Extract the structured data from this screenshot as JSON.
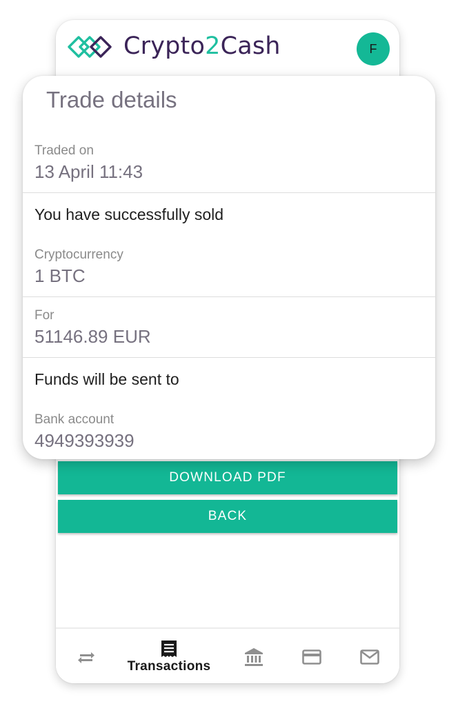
{
  "app": {
    "brand_prefix": "Crypto",
    "brand_digit": "2",
    "brand_suffix": "Cash",
    "avatar_initial": "F",
    "accent_color": "#13b795"
  },
  "modal": {
    "title": "Trade details",
    "traded_on_label": "Traded on",
    "traded_on_value": "13 April 11:43",
    "sold_heading": "You have successfully sold",
    "crypto_label": "Cryptocurrency",
    "crypto_value": "1 BTC",
    "for_label": "For",
    "for_value": "51146.89 EUR",
    "funds_heading": "Funds will be sent to",
    "bank_label": "Bank account",
    "bank_value": "4949393939"
  },
  "actions": {
    "download_label": "DOWNLOAD PDF",
    "back_label": "BACK"
  },
  "nav": {
    "items": [
      {
        "icon": "swap-arrows-icon",
        "label": ""
      },
      {
        "icon": "receipt-icon",
        "label": "Transactions",
        "active": true
      },
      {
        "icon": "bank-icon",
        "label": ""
      },
      {
        "icon": "credit-card-icon",
        "label": ""
      },
      {
        "icon": "mail-icon",
        "label": ""
      }
    ]
  }
}
